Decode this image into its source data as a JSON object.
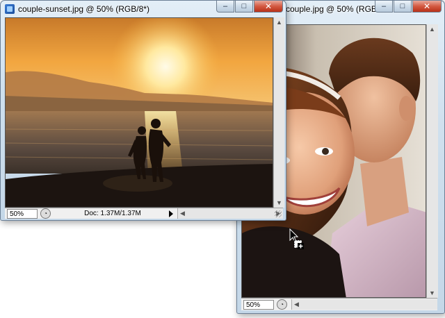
{
  "window_back": {
    "title": "couple.jpg @ 50% (RGB/...",
    "zoom": "50%",
    "controls": {
      "min": "–",
      "max": "□",
      "close": "✕"
    }
  },
  "window_front": {
    "title": "couple-sunset.jpg @ 50% (RGB/8*)",
    "zoom": "50%",
    "doc_info": "Doc: 1.37M/1.37M",
    "controls": {
      "min": "–",
      "max": "□",
      "close": "✕"
    }
  },
  "colors": {
    "titlebar": "#cfe0ee",
    "close_button": "#d35a42",
    "sunset_sky": "#f2a640",
    "water": "#5a4a40"
  }
}
